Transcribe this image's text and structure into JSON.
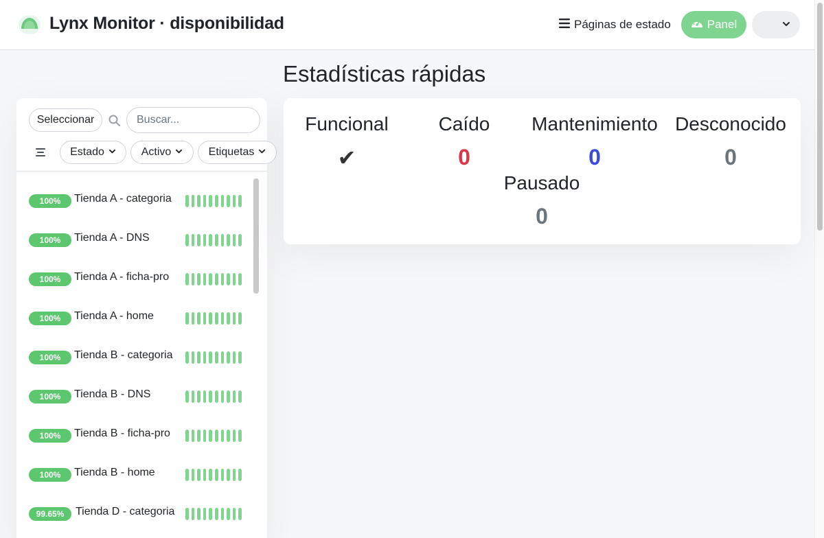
{
  "header": {
    "title": "Lynx Monitor · disponibilidad",
    "status_pages_label": "Páginas de estado",
    "panel_label": "Panel"
  },
  "list": {
    "select_label": "Seleccionar",
    "search_placeholder": "Buscar...",
    "filters": [
      "Estado",
      "Activo",
      "Etiquetas"
    ],
    "monitors": [
      {
        "uptime": "100%",
        "name": "Tienda A - categoria"
      },
      {
        "uptime": "100%",
        "name": "Tienda A - DNS"
      },
      {
        "uptime": "100%",
        "name": "Tienda A - ficha-pro"
      },
      {
        "uptime": "100%",
        "name": "Tienda A - home"
      },
      {
        "uptime": "100%",
        "name": "Tienda B - categoria"
      },
      {
        "uptime": "100%",
        "name": "Tienda B - DNS"
      },
      {
        "uptime": "100%",
        "name": "Tienda B - ficha-pro"
      },
      {
        "uptime": "100%",
        "name": "Tienda B - home"
      },
      {
        "uptime": "99.65%",
        "name": "Tienda D - categoria"
      }
    ]
  },
  "stats": {
    "heading": "Estadísticas rápidas",
    "items": [
      {
        "label": "Funcional",
        "value": "✔"
      },
      {
        "label": "Caído",
        "value": "0"
      },
      {
        "label": "Mantenimiento",
        "value": "0"
      },
      {
        "label": "Desconocido",
        "value": "0"
      },
      {
        "label": "Pausado",
        "value": "0"
      }
    ]
  },
  "colors": {
    "accent_green": "#5cc76f",
    "heartbeat_green": "#7fd48f",
    "down_red": "#dc3545",
    "maintenance_blue": "#3b4cdb",
    "unknown_gray": "#6c757d"
  },
  "icons": {
    "logo": "lynx-logo-icon",
    "status_pages": "list-icon",
    "panel": "gauge-icon",
    "search": "search-icon",
    "sort": "sort-icon",
    "dropdown": "chevron-down-icon"
  }
}
